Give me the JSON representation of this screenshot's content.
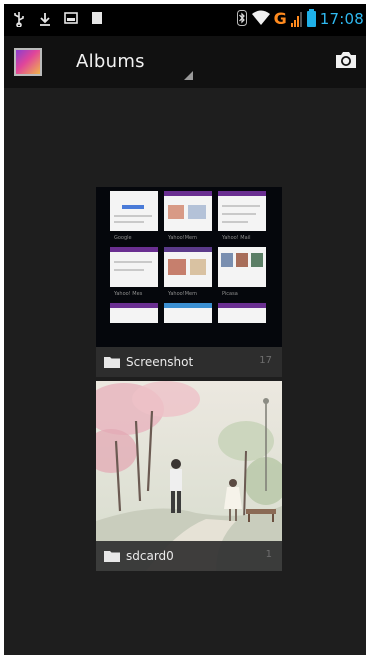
{
  "status_bar": {
    "left_icons": [
      "usb-icon",
      "download-icon",
      "gallery-icon",
      "sd-card-icon"
    ],
    "right_icons": [
      "bluetooth-icon",
      "wifi-icon",
      "signal-icon",
      "battery-icon"
    ],
    "network_type": "G",
    "time": "17:08",
    "accent_color": "#2fb8ef",
    "network_color": "#ff8a1e"
  },
  "action_bar": {
    "app_icon": "gallery-app-icon",
    "title": "Albums",
    "action_icon": "camera-icon"
  },
  "albums": [
    {
      "name": "Screenshot",
      "count": "17",
      "icon": "folder-icon",
      "thumb_captions": [
        "Google",
        "Yahoo!Mem",
        "Yahoo! Mail",
        "Yahoo! Mes",
        "Yahoo!Mem",
        "Picasa"
      ]
    },
    {
      "name": "sdcard0",
      "count": "1",
      "icon": "folder-icon"
    }
  ]
}
